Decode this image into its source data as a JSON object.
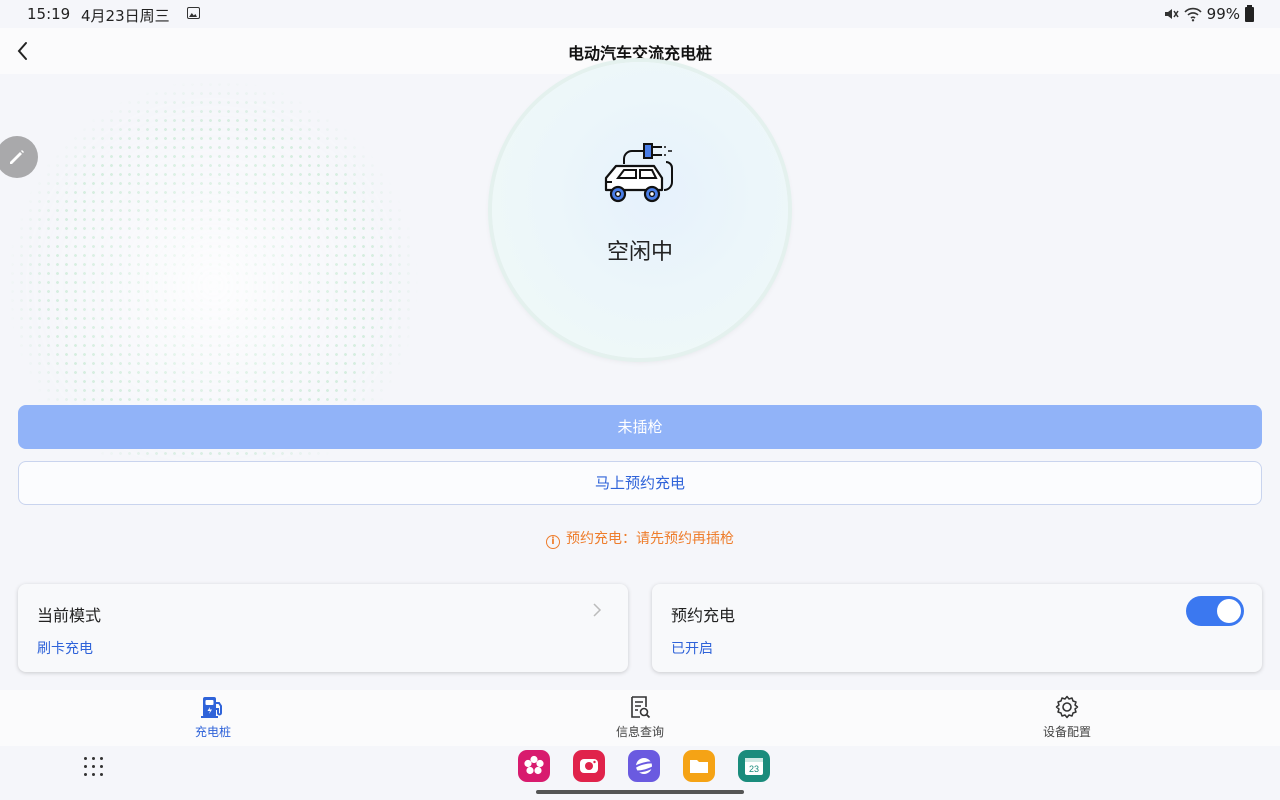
{
  "status_bar": {
    "time": "15:19",
    "date": "4月23日周三",
    "battery": "99%"
  },
  "header": {
    "title": "电动汽车交流充电桩"
  },
  "charger": {
    "state": "空闲中"
  },
  "actions": {
    "primary_label": "未插枪",
    "reserve_now_label": "马上预约充电",
    "notice": "预约充电：请先预约再插枪"
  },
  "cards": {
    "mode": {
      "title": "当前模式",
      "value": "刷卡充电"
    },
    "reserve": {
      "title": "预约充电",
      "value": "已开启",
      "enabled": true
    }
  },
  "bottom_nav": {
    "items": [
      {
        "label": "充电桩",
        "icon": "charging-station-icon",
        "active": true
      },
      {
        "label": "信息查询",
        "icon": "info-query-icon",
        "active": false
      },
      {
        "label": "设备配置",
        "icon": "gear-icon",
        "active": false
      }
    ]
  },
  "dock": {
    "apps": [
      {
        "icon": "flower-app-icon",
        "color": "#d81b6e"
      },
      {
        "icon": "camera-app-icon",
        "color": "#e0234b"
      },
      {
        "icon": "browser-app-icon",
        "color": "#6a5ae0"
      },
      {
        "icon": "folder-app-icon",
        "color": "#f5a315"
      },
      {
        "icon": "calendar-app-icon",
        "color": "#1a8c7c",
        "text": "23"
      }
    ]
  },
  "colors": {
    "accent": "#2f63d9",
    "primary_button": "#91b3f8",
    "toggle_on": "#3b78f0",
    "notice": "#ee7d2c"
  }
}
